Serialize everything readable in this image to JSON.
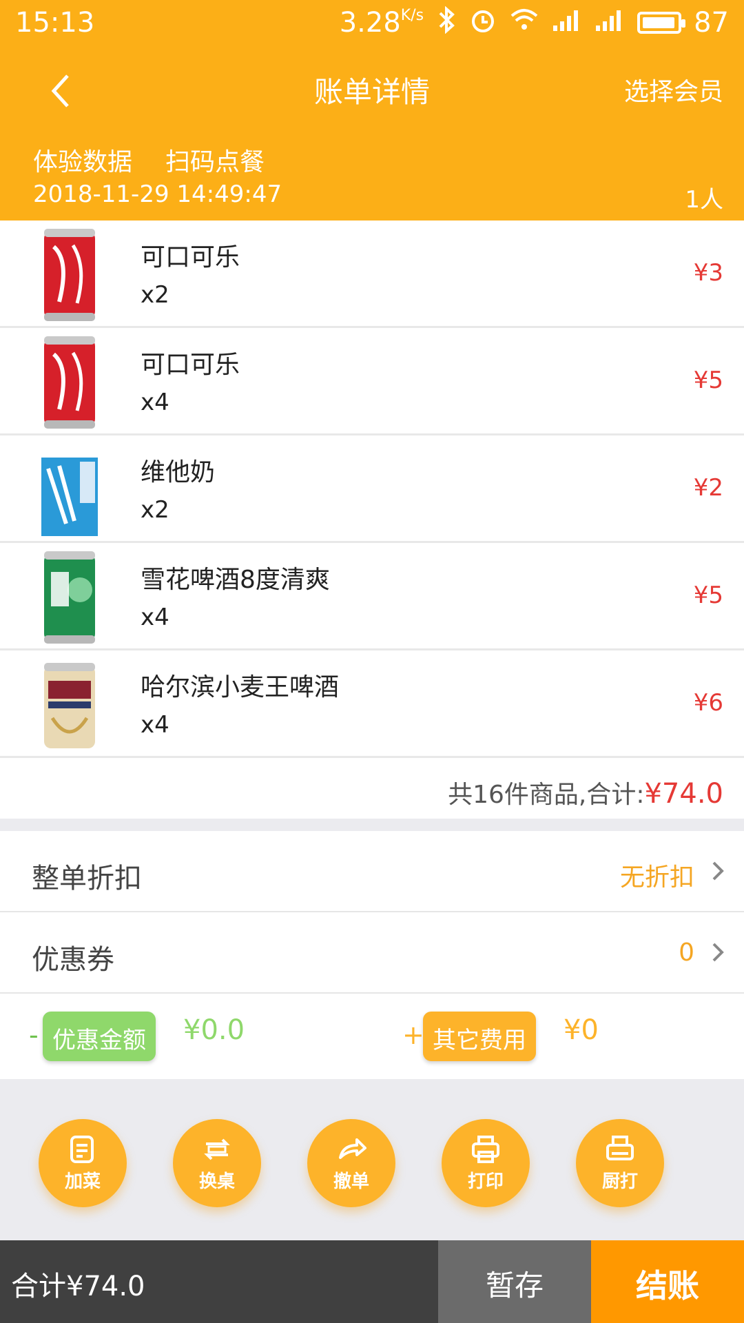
{
  "status": {
    "time": "15:13",
    "speed": "3.28",
    "speed_unit": "K/s",
    "battery": "87"
  },
  "header": {
    "title": "账单详情",
    "select_member": "选择会员",
    "tag1": "体验数据",
    "tag2": "扫码点餐",
    "datetime": "2018-11-29 14:49:47",
    "people": "1人"
  },
  "items": [
    {
      "name": "可口可乐",
      "qty": "x2",
      "price": "¥3",
      "icon": "coca-cola-can"
    },
    {
      "name": "可口可乐",
      "qty": "x4",
      "price": "¥5",
      "icon": "coca-cola-can"
    },
    {
      "name": "维他奶",
      "qty": "x2",
      "price": "¥2",
      "icon": "vitasoy-carton"
    },
    {
      "name": "雪花啤酒8度清爽",
      "qty": "x4",
      "price": "¥5",
      "icon": "snow-beer-can"
    },
    {
      "name": "哈尔滨小麦王啤酒",
      "qty": "x4",
      "price": "¥6",
      "icon": "harbin-beer-can"
    }
  ],
  "summary": {
    "label": "共16件商品,合计:",
    "total": "¥74.0"
  },
  "options": {
    "discount_label": "整单折扣",
    "discount_value": "无折扣",
    "coupon_label": "优惠券",
    "coupon_value": "0"
  },
  "fees": {
    "minus_sign": "-",
    "discount_badge": "优惠金额",
    "discount_amount": "¥0.0",
    "plus_sign": "+",
    "other_badge": "其它费用",
    "other_amount": "¥0"
  },
  "actions": [
    {
      "label": "加菜",
      "icon": "add-dish-icon"
    },
    {
      "label": "换桌",
      "icon": "change-table-icon"
    },
    {
      "label": "撤单",
      "icon": "undo-order-icon"
    },
    {
      "label": "打印",
      "icon": "print-icon"
    },
    {
      "label": "厨打",
      "icon": "kitchen-print-icon"
    }
  ],
  "bottom": {
    "total": "合计¥74.0",
    "save": "暂存",
    "pay": "结账"
  },
  "colors": {
    "brand": "#fcaf17",
    "price_red": "#e53935",
    "green_badge": "#8fd86b",
    "orange_badge": "#fdb32a",
    "pay_button": "#ff9800"
  }
}
